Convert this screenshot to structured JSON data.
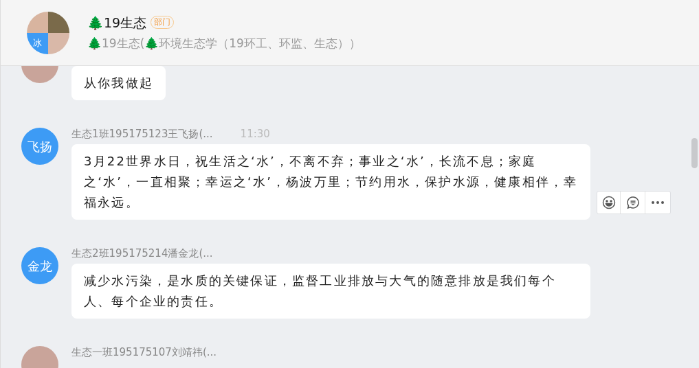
{
  "header": {
    "title": "🌲19生态",
    "badge": "部门",
    "subtitle": "🌲19生态(🌲环境生态学（19环工、环监、生态））",
    "group_avatar_label": "冰"
  },
  "messages": [
    {
      "avatar": {
        "kind": "photo"
      },
      "text": "从你我做起"
    },
    {
      "avatar": {
        "kind": "initials",
        "label": "飞扬"
      },
      "sender": "生态1班195175123王飞扬(...",
      "time": "11:30",
      "text": "3月22世界水日，祝生活之‘水’，不离不弃；事业之‘水’，长流不息；家庭之‘水’，一直相聚；幸运之‘水’，杨波万里；节约用水，保护水源，健康相伴，幸福永远。",
      "show_actions": true
    },
    {
      "avatar": {
        "kind": "initials",
        "label": "金龙"
      },
      "sender": "生态2班195175214潘金龙(...",
      "text": "减少水污染，是水质的关键保证，监督工业排放与大气的随意排放是我们每个人、每个企业的责任。",
      "show_actions": false
    },
    {
      "avatar": {
        "kind": "photo"
      },
      "sender": "生态一班195175107刘靖祎(..."
    }
  ]
}
